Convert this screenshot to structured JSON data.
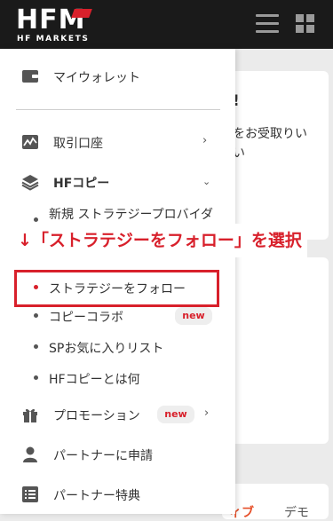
{
  "header": {
    "logo_main": "HFM",
    "logo_sub": "HF MARKETS",
    "brand_color": "#d8202b",
    "menu_icon": "hamburger-icon",
    "grid_icon": "grid-icon"
  },
  "background": {
    "exclamation": "!",
    "text1": "をお受取りい",
    "text2": "い",
    "text3": "ィブ",
    "text4": "デモ"
  },
  "menu": {
    "wallet": {
      "label": "マイウォレット",
      "icon": "wallet-icon"
    },
    "trading_account": {
      "label": "取引口座",
      "icon": "chart-icon"
    },
    "hfcopy": {
      "label": "HFコピー",
      "icon": "layers-icon"
    },
    "hfcopy_sub": [
      {
        "label": "新規 ストラテジープロバイダ"
      },
      {
        "label": "ストラテジーをフォロー"
      },
      {
        "label": "コピーコラボ",
        "badge": "new"
      },
      {
        "label": "SPお気に入りリスト"
      },
      {
        "label": "HFコピーとは何"
      }
    ],
    "promotion": {
      "label": "プロモーション",
      "badge": "new",
      "icon": "gift-icon"
    },
    "partner_apply": {
      "label": "パートナーに申請",
      "icon": "person-icon"
    },
    "partner_benefits": {
      "label": "パートナー特典",
      "icon": "list-icon"
    }
  },
  "annotation": {
    "text": "↓「ストラテジーをフォロー」を選択"
  }
}
